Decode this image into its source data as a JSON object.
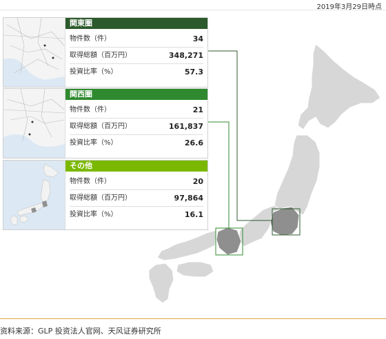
{
  "header": {
    "date": "2019年3月29日時点"
  },
  "source": "资料来源：GLP 投资法人官网、天风证券研究所",
  "colors": {
    "kanto": "#2c5a2c",
    "kansai": "#2f8a2f",
    "other": "#7ab800",
    "map_land": "#d7d7d7",
    "map_highlight": "#8f8f8f"
  },
  "regions": [
    {
      "key": "kanto",
      "title": "関東圏",
      "rows": [
        {
          "label": "物件数（件）",
          "value": "34"
        },
        {
          "label": "取得総額（百万円）",
          "value": "348,271"
        },
        {
          "label": "投資比率（%）",
          "value": "57.3"
        }
      ]
    },
    {
      "key": "kansai",
      "title": "関西圏",
      "rows": [
        {
          "label": "物件数（件）",
          "value": "21"
        },
        {
          "label": "取得総額（百万円）",
          "value": "161,837"
        },
        {
          "label": "投資比率（%）",
          "value": "26.6"
        }
      ]
    },
    {
      "key": "other",
      "title": "その他",
      "rows": [
        {
          "label": "物件数（件）",
          "value": "20"
        },
        {
          "label": "取得総額（百万円）",
          "value": "97,864"
        },
        {
          "label": "投資比率（%）",
          "value": "16.1"
        }
      ]
    }
  ]
}
